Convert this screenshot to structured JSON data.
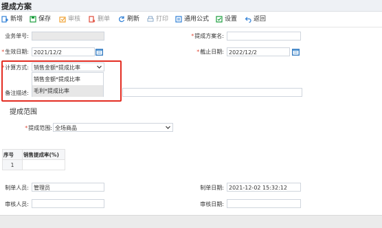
{
  "window": {
    "title": "提成方案"
  },
  "toolbar": {
    "new": "新增",
    "save": "保存",
    "audit": "审核",
    "delete": "删单",
    "refresh": "刷新",
    "print": "打印",
    "formula": "通用公式",
    "settings": "设置",
    "back": "返回"
  },
  "form": {
    "doc_no_label": "业务单号:",
    "doc_no_value": "",
    "scheme_name_label": "提成方案名:",
    "scheme_name_value": "",
    "effective_date_label": "生效日期:",
    "effective_date_value": "2021/12/2",
    "deadline_label": "截止日期:",
    "deadline_value": "2022/12/2",
    "calc_method_label": "计算方式:",
    "calc_method_value": "销售金额*提成比率",
    "calc_method_options": [
      "销售金额*提成比率",
      "毛利*提成比率"
    ],
    "remark_label": "备注描述:",
    "remark_value": ""
  },
  "scope": {
    "section_title": "提成范围",
    "label": "提成范围:",
    "value": "全场商品"
  },
  "grid": {
    "columns": [
      "序号",
      "销售提成率(%)"
    ],
    "rows": [
      {
        "index": "1",
        "rate": ""
      }
    ]
  },
  "footer": {
    "creator_label": "制单人员:",
    "creator_value": "管理员",
    "created_label": "制单日期:",
    "created_value": "2021-12-02 15:32:12",
    "auditor_label": "审核人员:",
    "auditor_value": "",
    "audit_date_label": "审核日期:",
    "audit_date_value": ""
  },
  "colors": {
    "accent": "#2e7fd6",
    "required": "#e04b3a",
    "highlight_box": "#e32b20"
  }
}
